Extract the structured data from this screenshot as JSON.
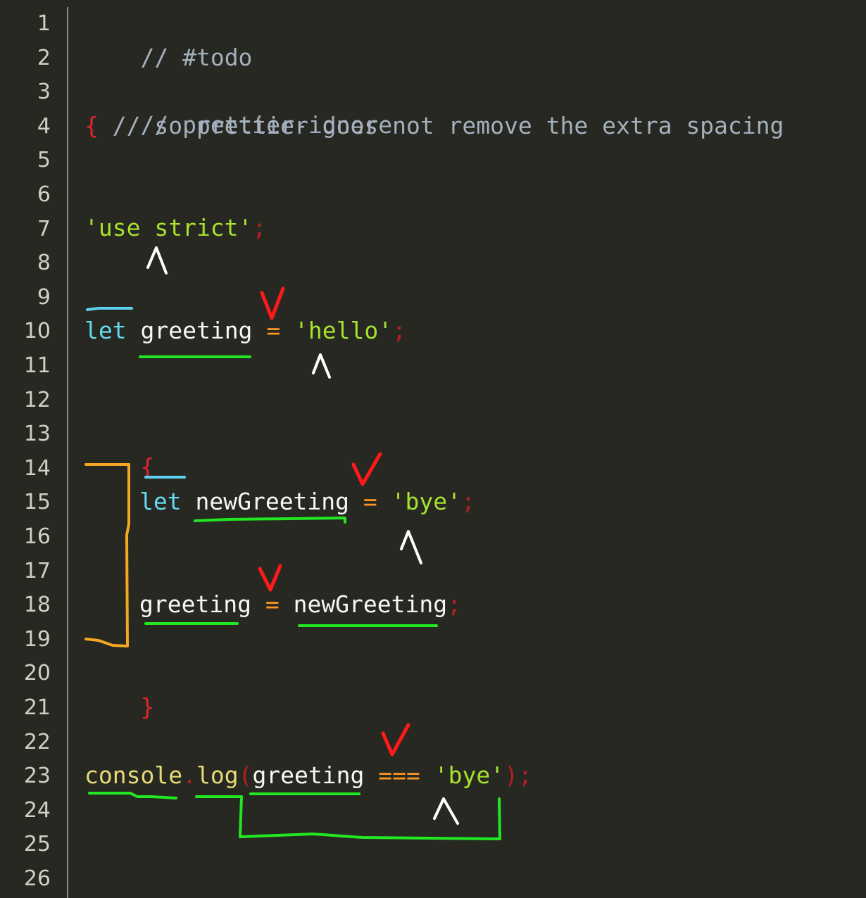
{
  "editor": {
    "line_numbers": [
      "1",
      "2",
      "3",
      "4",
      "5",
      "6",
      "7",
      "8",
      "9",
      "10",
      "11",
      "12",
      "13",
      "14",
      "15",
      "16",
      "17",
      "18",
      "19",
      "20",
      "21",
      "22",
      "23",
      "24",
      "25",
      "26"
    ],
    "line1": {
      "comment": "// #todo"
    },
    "line3": {
      "comment": "// prettier-ignore"
    },
    "line4": {
      "brace": "{",
      "comment": " // so prettier does not remove the extra spacing"
    },
    "line7": {
      "string": "'use strict'",
      "semicolon": ";"
    },
    "line10": {
      "keyword": "let",
      "identifier": "greeting",
      "operator": "=",
      "string": "'hello'",
      "semicolon": ";"
    },
    "line13": {
      "brace": "{"
    },
    "line15": {
      "keyword": "let",
      "identifier": "newGreeting",
      "operator": "=",
      "string": "'bye'",
      "semicolon": ";"
    },
    "line18": {
      "identifier": "greeting",
      "operator": "=",
      "value": "newGreeting",
      "semicolon": ";"
    },
    "line20": {
      "brace": "}"
    },
    "line23": {
      "object": "console",
      "dot": ".",
      "method": "log",
      "open_paren": "(",
      "argument": "greeting",
      "operator": "===",
      "string": "'bye'",
      "close_paren": ")",
      "semicolon": ";"
    },
    "line26": {
      "brace": "}"
    }
  },
  "colors": {
    "background": "#272822",
    "comment": "#a4b0bd",
    "string": "#a6e22e",
    "keyword": "#66d9ef",
    "operator": "#fd971f",
    "brace": "#e0262d",
    "annotation_green": "#22e823",
    "annotation_red": "#ff1a1a",
    "annotation_blue": "#5ed0ef",
    "annotation_orange": "#f5a623",
    "annotation_white": "#ffffff"
  }
}
